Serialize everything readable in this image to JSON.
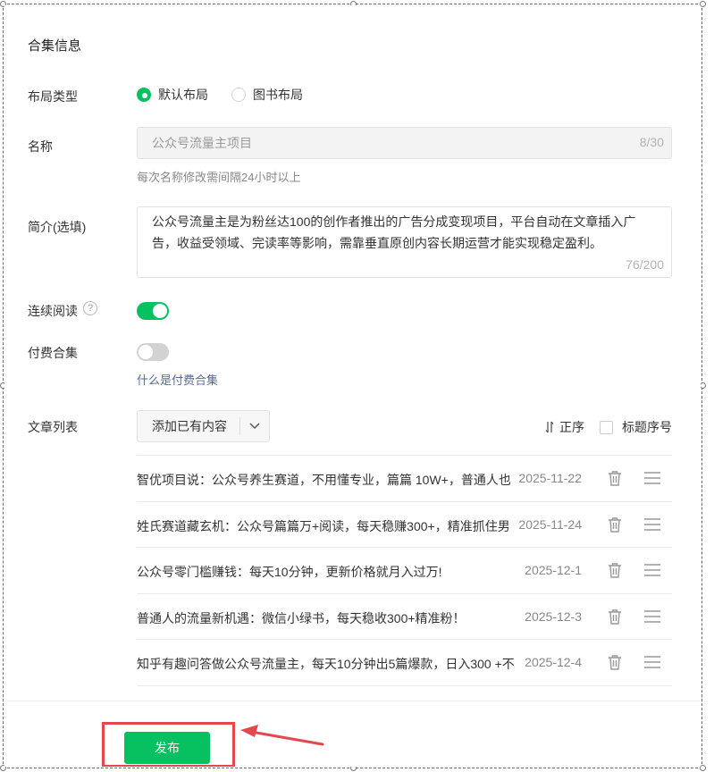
{
  "form": {
    "title": "合集信息",
    "layout": {
      "label": "布局类型",
      "options": [
        "默认布局",
        "图书布局"
      ],
      "selected": "默认布局"
    },
    "name": {
      "label": "名称",
      "value": "公众号流量主项目",
      "counter": "8/30",
      "hint": "每次名称修改需间隔24小时以上"
    },
    "intro": {
      "label": "简介(选填)",
      "value": "公众号流量主是为粉丝达100的创作者推出的广告分成变现项目，平台自动在文章插入广告，收益受领域、完读率等影响，需靠垂直原创内容长期运营才能实现稳定盈利。",
      "counter": "76/200"
    },
    "continuous_read": {
      "label": "连续阅读",
      "help": "?",
      "enabled": true
    },
    "paid": {
      "label": "付费合集",
      "enabled": false,
      "link": "什么是付费合集"
    },
    "articles": {
      "label": "文章列表",
      "add_button": "添加已有内容",
      "sort_label": "正序",
      "number_label": "标题序号",
      "items": [
        {
          "title": "智优项目说：公众号养生赛道，不用懂专业，篇篇 10W+，普通人也",
          "date": "2025-11-22"
        },
        {
          "title": "姓氏赛道藏玄机：公众号篇篇万+阅读，每天稳赚300+，精准抓住男",
          "date": "2025-11-24"
        },
        {
          "title": "公众号零门槛赚钱：每天10分钟，更新价格就月入过万!",
          "date": "2025-12-1"
        },
        {
          "title": "普通人的流量新机遇：微信小绿书，每天稳收300+精准粉！",
          "date": "2025-12-3"
        },
        {
          "title": "知乎有趣问答做公众号流量主，每天10分钟出5篇爆款，日入300 +不",
          "date": "2025-12-4"
        },
        {
          "title": "",
          "date": ""
        }
      ]
    }
  },
  "footer": {
    "publish_label": "发布"
  },
  "colors": {
    "accent": "#07c160",
    "link": "#576b95",
    "highlight": "#e4484f"
  },
  "icons": {
    "delete": "trash-icon",
    "drag": "drag-handle-icon",
    "sort": "sort-icon",
    "dropdown": "chevron-down-icon"
  }
}
